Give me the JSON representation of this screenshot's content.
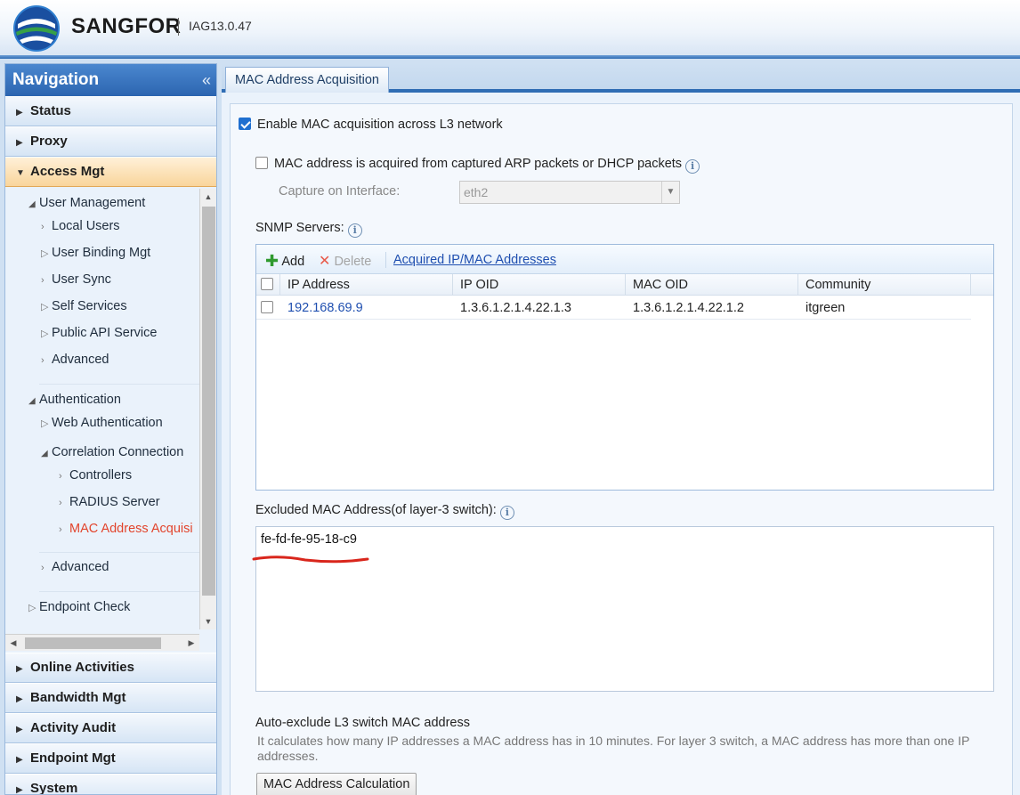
{
  "header": {
    "brand": "SANGFOR",
    "version": "IAG13.0.47"
  },
  "navigation": {
    "title": "Navigation",
    "collapse": "«",
    "top_sections": [
      {
        "label": "Status",
        "expanded": false
      },
      {
        "label": "Proxy",
        "expanded": false
      },
      {
        "label": "Access Mgt",
        "expanded": true
      }
    ],
    "tree": {
      "user_management": "User Management",
      "local_users": "Local Users",
      "user_binding": "User Binding Mgt",
      "user_sync": "User Sync",
      "self_services": "Self Services",
      "public_api": "Public API Service",
      "advanced_1": "Advanced",
      "authentication": "Authentication",
      "web_auth": "Web Authentication",
      "correlation": "Correlation Connection",
      "controllers": "Controllers",
      "radius": "RADIUS Server",
      "mac_acq": "MAC Address Acquisi",
      "advanced_2": "Advanced",
      "endpoint_check": "Endpoint Check"
    },
    "bottom_sections": [
      {
        "label": "Online Activities"
      },
      {
        "label": "Bandwidth Mgt"
      },
      {
        "label": "Activity Audit"
      },
      {
        "label": "Endpoint Mgt"
      },
      {
        "label": "System"
      }
    ]
  },
  "main": {
    "tab": "MAC Address Acquisition",
    "enable_l3": {
      "label": "Enable MAC acquisition across L3 network",
      "checked": true
    },
    "arp_dhcp": {
      "label": "MAC address is acquired from captured ARP packets or DHCP packets",
      "checked": false
    },
    "capture_label": "Capture on Interface:",
    "capture_value": "eth2",
    "snmp_label": "SNMP Servers:",
    "toolbar": {
      "add": "Add",
      "delete": "Delete",
      "acquired_link": "Acquired IP/MAC Addresses"
    },
    "grid": {
      "columns": [
        "IP Address",
        "IP OID",
        "MAC OID",
        "Community"
      ],
      "rows": [
        {
          "ip": "192.168.69.9",
          "ip_oid": "1.3.6.1.2.1.4.22.1.3",
          "mac_oid": "1.3.6.1.2.1.4.22.1.2",
          "community": "itgreen"
        }
      ]
    },
    "excluded_label": "Excluded MAC Address(of layer-3 switch):",
    "excluded_value": "fe-fd-fe-95-18-c9",
    "auto_exclude_title": "Auto-exclude L3 switch MAC address",
    "auto_exclude_desc": "It calculates how many IP addresses a MAC address has in 10 minutes. For layer 3 switch, a MAC address has more than one IP addresses.",
    "calc_button": "MAC Address Calculation"
  },
  "colors": {
    "accent": "#2f6db4",
    "selected_nav": "#e2442c",
    "link": "#1f4fb0",
    "annotation": "#d9261c"
  }
}
